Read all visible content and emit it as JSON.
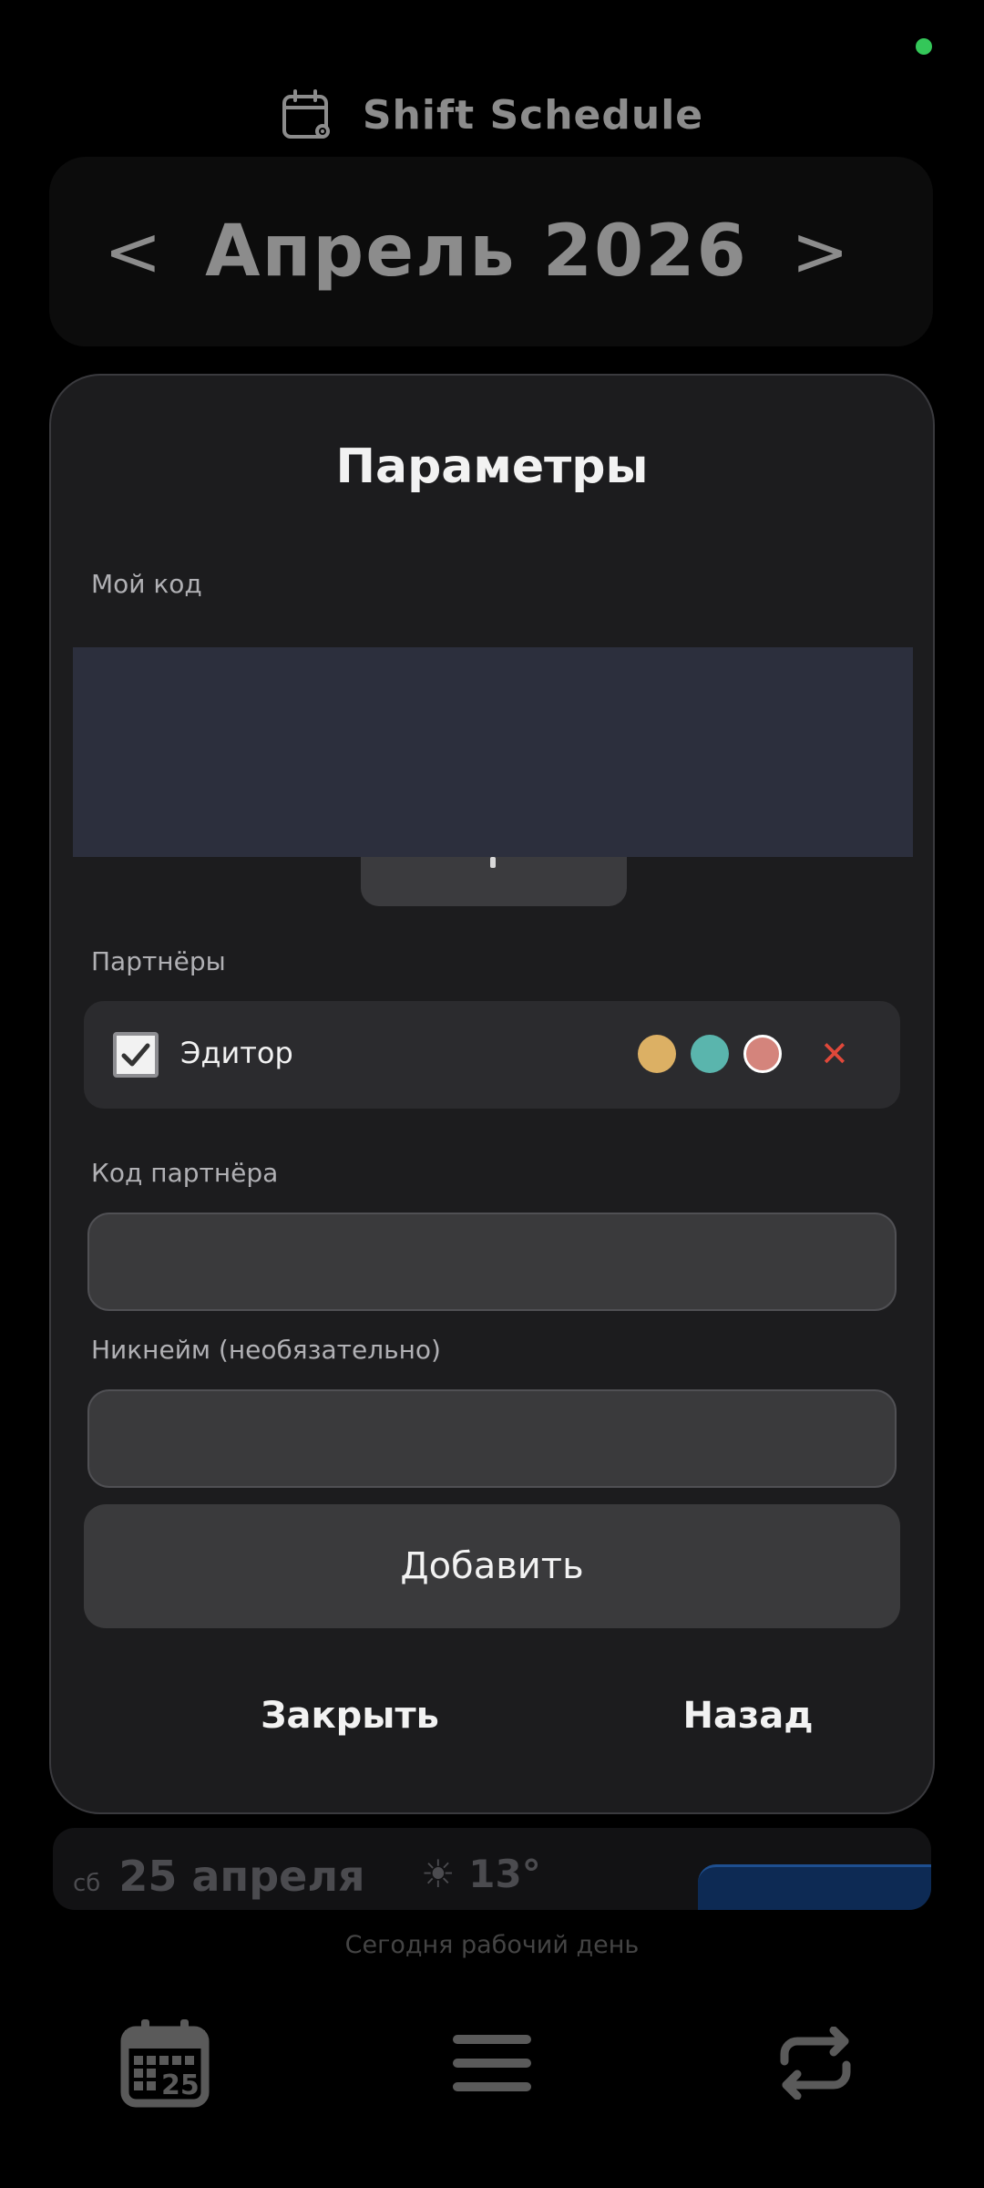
{
  "header": {
    "title": "Shift Schedule",
    "logo_icon": "calendar-gear-icon"
  },
  "status": {
    "indicator_color": "#34c759"
  },
  "month_nav": {
    "prev_label": "<",
    "month": "Апрель 2026",
    "next_label": ">"
  },
  "background": {
    "day_date": "25 апреля",
    "day_abbrev": "сб",
    "weather": "☀ 13°",
    "today_text": "Сегодня рабочий день"
  },
  "bottom_nav": {
    "items": [
      {
        "icon": "calendar-25-icon"
      },
      {
        "icon": "menu-icon"
      },
      {
        "icon": "sync-icon"
      }
    ]
  },
  "settings_modal": {
    "title": "Параметры",
    "my_code_label": "Мой код",
    "partners_label": "Партнёры",
    "partners": [
      {
        "name": "Эдитор",
        "checked": true,
        "colors": [
          "#dcb064",
          "#5ab5ad",
          "#d4847c"
        ]
      }
    ],
    "partner_code_label": "Код партнёра",
    "partner_code_value": "",
    "nickname_label": "Никнейм (необязательно)",
    "nickname_value": "",
    "add_button": "Добавить",
    "close_button": "Закрыть",
    "back_button": "Назад",
    "accent_danger": "#e0483a"
  }
}
